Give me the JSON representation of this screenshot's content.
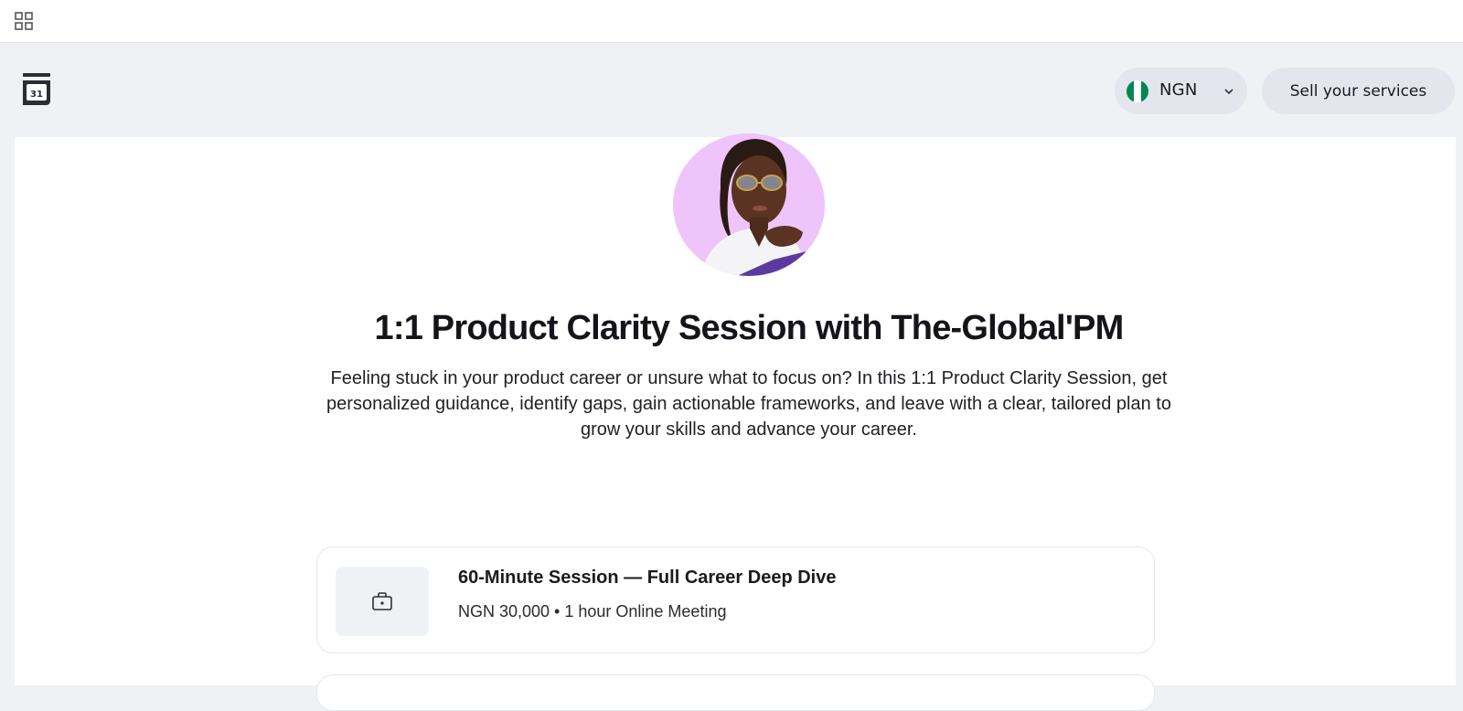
{
  "header": {
    "currency": {
      "code": "NGN"
    },
    "sell_label": "Sell your services"
  },
  "logo": {
    "date_number": "31"
  },
  "profile": {
    "title": "1:1 Product Clarity Session with The-Global'PM",
    "description": "Feeling stuck in your product career or unsure what to focus on? In this 1:1 Product Clarity Session, get personalized guidance, identify gaps, gain actionable frameworks, and leave with a clear, tailored plan to grow your skills and advance your career."
  },
  "services": [
    {
      "title": "60-Minute Session — Full Career Deep Dive",
      "meta": "NGN 30,000 • 1 hour Online Meeting",
      "icon": "briefcase-icon"
    }
  ],
  "colors": {
    "background": "#eff1f5",
    "pill": "#e3e6ec",
    "avatar_bg": "#eec4fa",
    "flag_green": "#008751"
  }
}
